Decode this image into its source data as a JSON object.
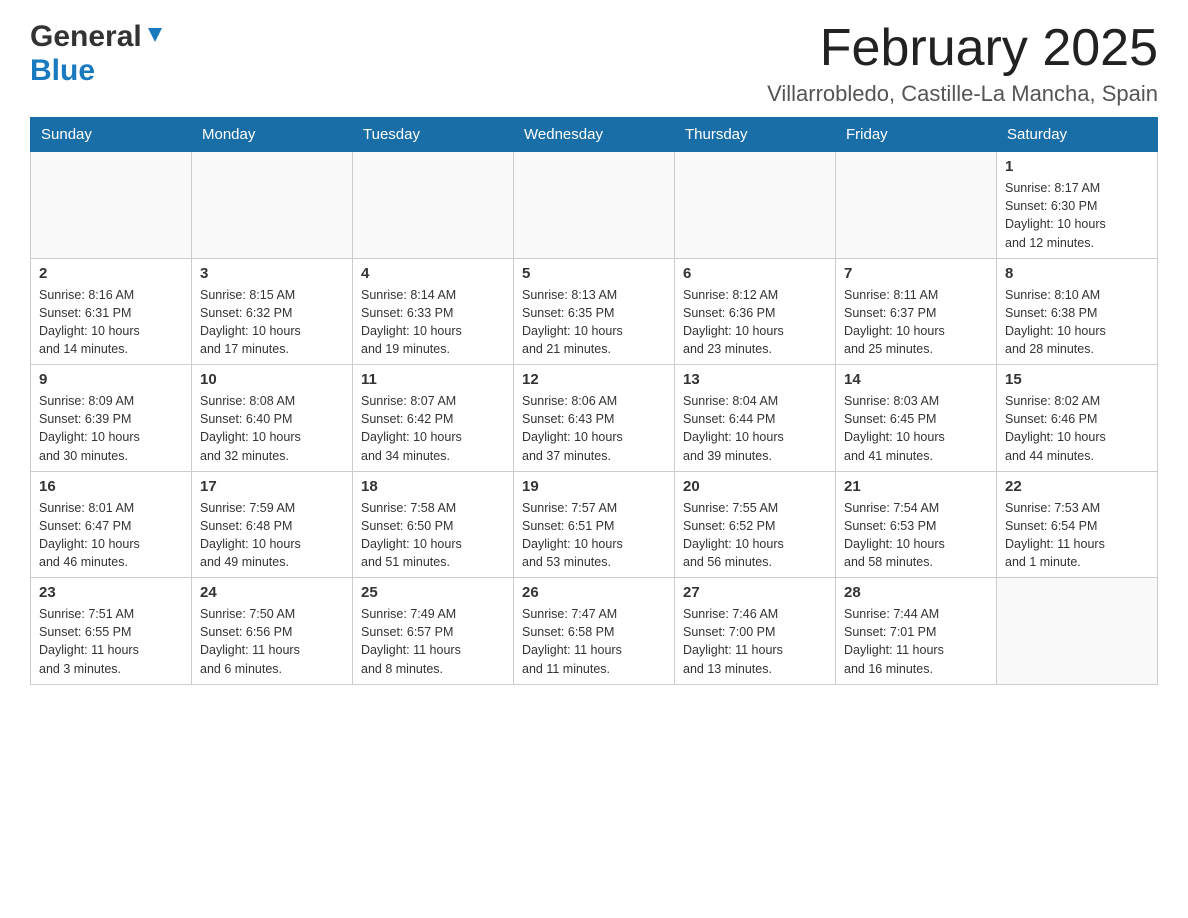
{
  "header": {
    "logo_general": "General",
    "logo_blue": "Blue",
    "title": "February 2025",
    "subtitle": "Villarrobledo, Castille-La Mancha, Spain"
  },
  "weekdays": [
    "Sunday",
    "Monday",
    "Tuesday",
    "Wednesday",
    "Thursday",
    "Friday",
    "Saturday"
  ],
  "weeks": [
    [
      {
        "day": "",
        "info": ""
      },
      {
        "day": "",
        "info": ""
      },
      {
        "day": "",
        "info": ""
      },
      {
        "day": "",
        "info": ""
      },
      {
        "day": "",
        "info": ""
      },
      {
        "day": "",
        "info": ""
      },
      {
        "day": "1",
        "info": "Sunrise: 8:17 AM\nSunset: 6:30 PM\nDaylight: 10 hours\nand 12 minutes."
      }
    ],
    [
      {
        "day": "2",
        "info": "Sunrise: 8:16 AM\nSunset: 6:31 PM\nDaylight: 10 hours\nand 14 minutes."
      },
      {
        "day": "3",
        "info": "Sunrise: 8:15 AM\nSunset: 6:32 PM\nDaylight: 10 hours\nand 17 minutes."
      },
      {
        "day": "4",
        "info": "Sunrise: 8:14 AM\nSunset: 6:33 PM\nDaylight: 10 hours\nand 19 minutes."
      },
      {
        "day": "5",
        "info": "Sunrise: 8:13 AM\nSunset: 6:35 PM\nDaylight: 10 hours\nand 21 minutes."
      },
      {
        "day": "6",
        "info": "Sunrise: 8:12 AM\nSunset: 6:36 PM\nDaylight: 10 hours\nand 23 minutes."
      },
      {
        "day": "7",
        "info": "Sunrise: 8:11 AM\nSunset: 6:37 PM\nDaylight: 10 hours\nand 25 minutes."
      },
      {
        "day": "8",
        "info": "Sunrise: 8:10 AM\nSunset: 6:38 PM\nDaylight: 10 hours\nand 28 minutes."
      }
    ],
    [
      {
        "day": "9",
        "info": "Sunrise: 8:09 AM\nSunset: 6:39 PM\nDaylight: 10 hours\nand 30 minutes."
      },
      {
        "day": "10",
        "info": "Sunrise: 8:08 AM\nSunset: 6:40 PM\nDaylight: 10 hours\nand 32 minutes."
      },
      {
        "day": "11",
        "info": "Sunrise: 8:07 AM\nSunset: 6:42 PM\nDaylight: 10 hours\nand 34 minutes."
      },
      {
        "day": "12",
        "info": "Sunrise: 8:06 AM\nSunset: 6:43 PM\nDaylight: 10 hours\nand 37 minutes."
      },
      {
        "day": "13",
        "info": "Sunrise: 8:04 AM\nSunset: 6:44 PM\nDaylight: 10 hours\nand 39 minutes."
      },
      {
        "day": "14",
        "info": "Sunrise: 8:03 AM\nSunset: 6:45 PM\nDaylight: 10 hours\nand 41 minutes."
      },
      {
        "day": "15",
        "info": "Sunrise: 8:02 AM\nSunset: 6:46 PM\nDaylight: 10 hours\nand 44 minutes."
      }
    ],
    [
      {
        "day": "16",
        "info": "Sunrise: 8:01 AM\nSunset: 6:47 PM\nDaylight: 10 hours\nand 46 minutes."
      },
      {
        "day": "17",
        "info": "Sunrise: 7:59 AM\nSunset: 6:48 PM\nDaylight: 10 hours\nand 49 minutes."
      },
      {
        "day": "18",
        "info": "Sunrise: 7:58 AM\nSunset: 6:50 PM\nDaylight: 10 hours\nand 51 minutes."
      },
      {
        "day": "19",
        "info": "Sunrise: 7:57 AM\nSunset: 6:51 PM\nDaylight: 10 hours\nand 53 minutes."
      },
      {
        "day": "20",
        "info": "Sunrise: 7:55 AM\nSunset: 6:52 PM\nDaylight: 10 hours\nand 56 minutes."
      },
      {
        "day": "21",
        "info": "Sunrise: 7:54 AM\nSunset: 6:53 PM\nDaylight: 10 hours\nand 58 minutes."
      },
      {
        "day": "22",
        "info": "Sunrise: 7:53 AM\nSunset: 6:54 PM\nDaylight: 11 hours\nand 1 minute."
      }
    ],
    [
      {
        "day": "23",
        "info": "Sunrise: 7:51 AM\nSunset: 6:55 PM\nDaylight: 11 hours\nand 3 minutes."
      },
      {
        "day": "24",
        "info": "Sunrise: 7:50 AM\nSunset: 6:56 PM\nDaylight: 11 hours\nand 6 minutes."
      },
      {
        "day": "25",
        "info": "Sunrise: 7:49 AM\nSunset: 6:57 PM\nDaylight: 11 hours\nand 8 minutes."
      },
      {
        "day": "26",
        "info": "Sunrise: 7:47 AM\nSunset: 6:58 PM\nDaylight: 11 hours\nand 11 minutes."
      },
      {
        "day": "27",
        "info": "Sunrise: 7:46 AM\nSunset: 7:00 PM\nDaylight: 11 hours\nand 13 minutes."
      },
      {
        "day": "28",
        "info": "Sunrise: 7:44 AM\nSunset: 7:01 PM\nDaylight: 11 hours\nand 16 minutes."
      },
      {
        "day": "",
        "info": ""
      }
    ]
  ]
}
